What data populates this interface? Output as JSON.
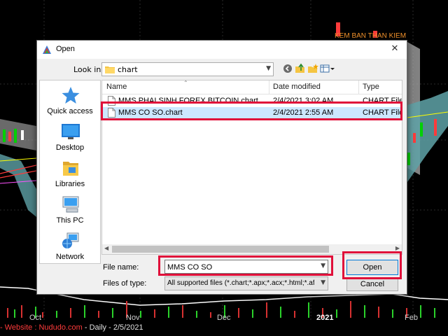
{
  "dialog": {
    "title": "Open",
    "look_in_label": "Look in:",
    "look_in_value": "chart",
    "places": [
      {
        "label": "Quick access",
        "icon": "star-icon"
      },
      {
        "label": "Desktop",
        "icon": "desktop-icon"
      },
      {
        "label": "Libraries",
        "icon": "libraries-icon"
      },
      {
        "label": "This PC",
        "icon": "computer-icon"
      },
      {
        "label": "Network",
        "icon": "network-icon"
      }
    ],
    "columns": {
      "name": "Name",
      "date": "Date modified",
      "type": "Type"
    },
    "files": [
      {
        "name": "MMS PHAI SINH FOREX BITCOIN.chart",
        "date": "2/4/2021 3:02 AM",
        "type": "CHART File",
        "selected": false
      },
      {
        "name": "MMS CO SO.chart",
        "date": "2/4/2021 2:55 AM",
        "type": "CHART File",
        "selected": true
      }
    ],
    "file_name_label": "File name:",
    "file_name_value": "MMS CO SO",
    "file_type_label": "Files of type:",
    "file_type_value": "All supported files (*.chart;*.apx;*.acx;*.html;*.afl;*.ab",
    "open_label": "Open",
    "cancel_label": "Cancel"
  },
  "chart": {
    "x_labels": [
      {
        "label": "Oct"
      },
      {
        "label": "Nov"
      },
      {
        "label": "Dec"
      },
      {
        "label": "2021"
      },
      {
        "label": "Feb"
      }
    ],
    "ticker": {
      "prefix": "- ",
      "website_label": "Website : ",
      "website": "Nududo.com",
      "rest": " - Daily  - 2/5/2021"
    },
    "overlay_text": "KEM BAN THAN KIEM"
  },
  "colors": {
    "highlight": "#e0103a",
    "selection": "#cce8ff",
    "accent": "#0078d7"
  }
}
